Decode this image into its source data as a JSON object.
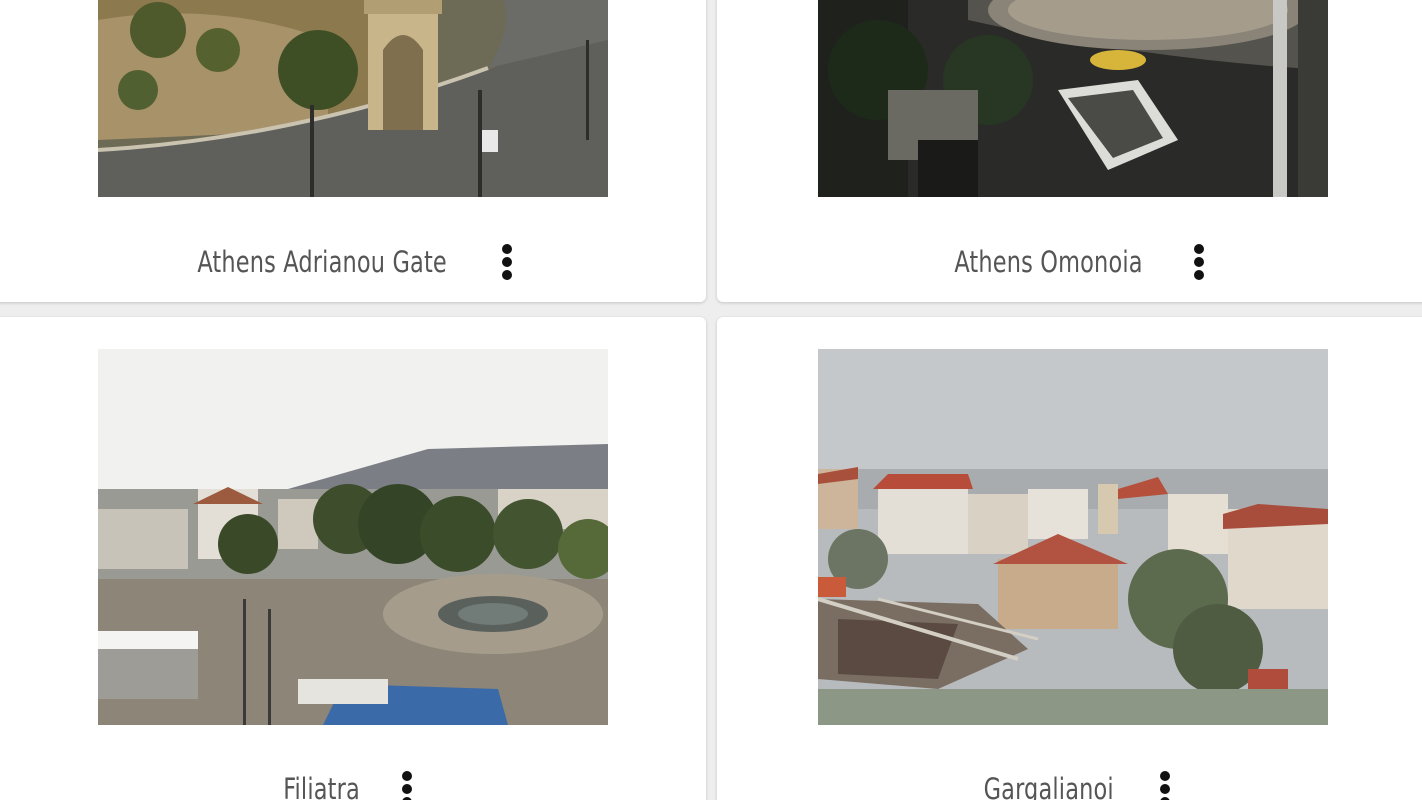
{
  "webcams": [
    {
      "title": "Athens Adrianou Gate",
      "menu_icon": "more-vert-icon"
    },
    {
      "title": "Athens Omonoia",
      "menu_icon": "more-vert-icon"
    },
    {
      "title": "Filiatra",
      "menu_icon": "more-vert-icon"
    },
    {
      "title": "Gargalianoi",
      "menu_icon": "more-vert-icon"
    }
  ],
  "colors": {
    "background": "#eeeeee",
    "card": "#ffffff",
    "title_text": "#555555",
    "icon": "#111111"
  }
}
